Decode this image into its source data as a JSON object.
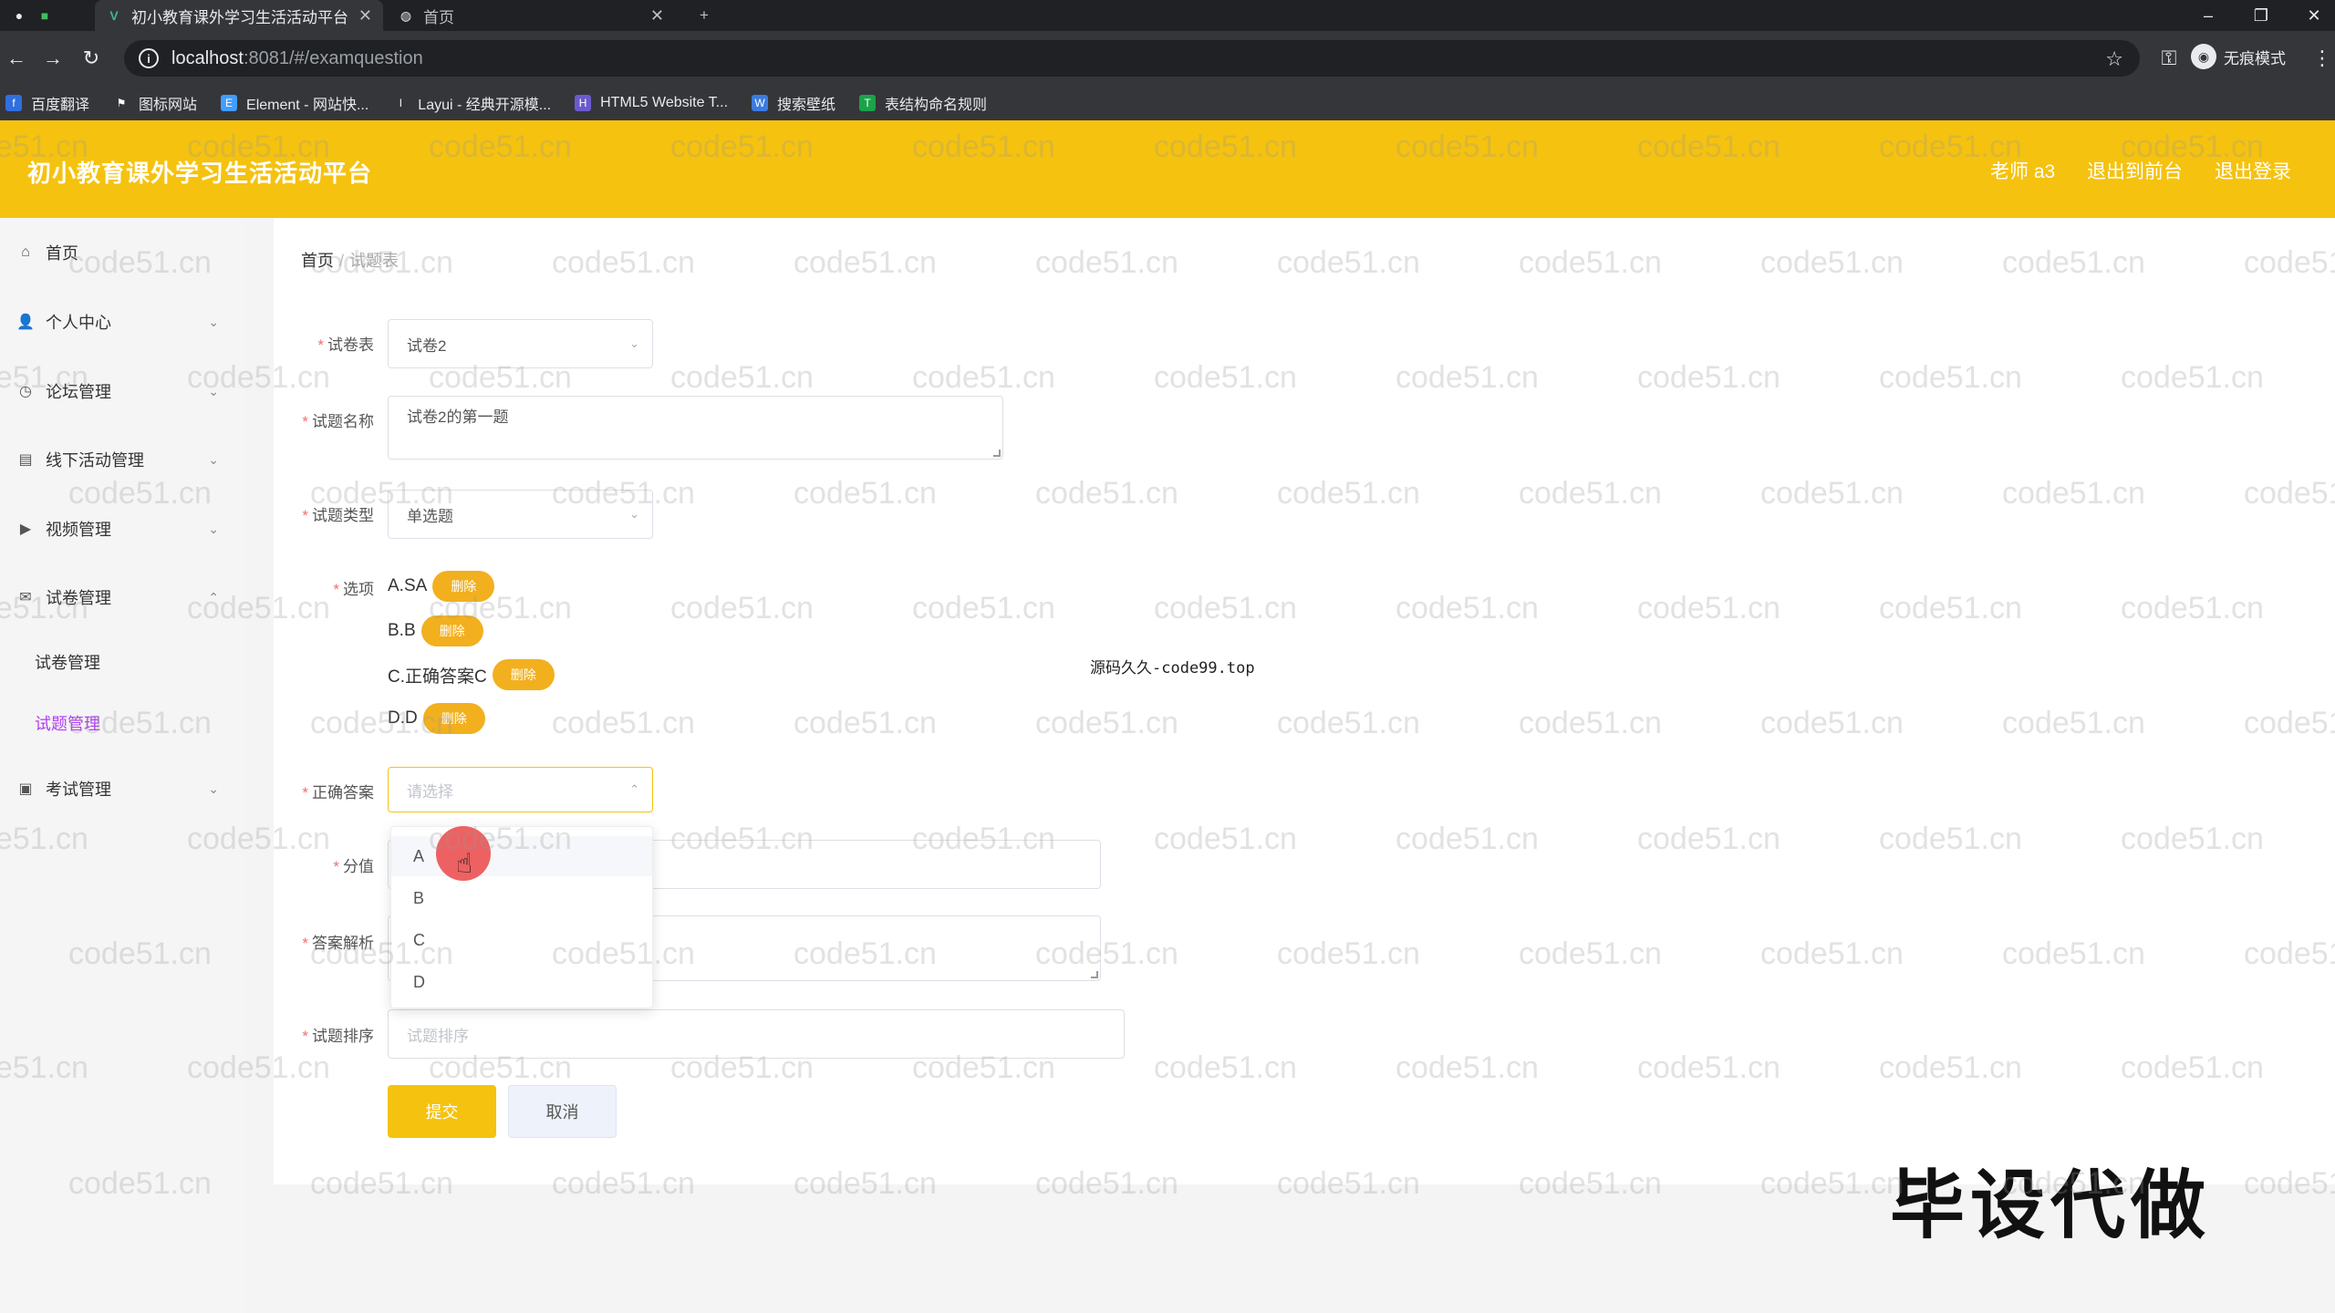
{
  "browser": {
    "tabs": [
      {
        "title": "初小教育课外学习生活活动平台",
        "active": true
      },
      {
        "title": "首页",
        "active": false
      }
    ],
    "url_host": "localhost",
    "url_path": ":8081/#/examquestion",
    "profile": "无痕模式",
    "bookmarks": [
      "百度翻译",
      "图标网站",
      "Element - 网站快...",
      "Layui - 经典开源模...",
      "HTML5 Website T...",
      "搜索壁纸",
      "表结构命名规则"
    ]
  },
  "header": {
    "title": "初小教育课外学习生活活动平台",
    "user": "老师 a3",
    "front_link": "退出到前台",
    "logout_link": "退出登录"
  },
  "sidebar": {
    "items": [
      {
        "label": "首页",
        "icon": "home-icon"
      },
      {
        "label": "个人中心",
        "icon": "user-icon"
      },
      {
        "label": "论坛管理",
        "icon": "clock-icon"
      },
      {
        "label": "线下活动管理",
        "icon": "doc-icon"
      },
      {
        "label": "视频管理",
        "icon": "video-icon"
      },
      {
        "label": "试卷管理",
        "icon": "mail-icon"
      },
      {
        "label": "考试管理",
        "icon": "briefcase-icon"
      }
    ],
    "subitems": [
      "试卷管理",
      "试题管理"
    ]
  },
  "breadcrumb": {
    "home": "首页",
    "sep": "/",
    "current": "试题表"
  },
  "form": {
    "paper_label": "试卷表",
    "paper_value": "试卷2",
    "name_label": "试题名称",
    "name_value": "试卷2的第一题",
    "type_label": "试题类型",
    "type_value": "单选题",
    "options_label": "选项",
    "options": [
      "A.SA",
      "B.B",
      "C.正确答案C",
      "D.D"
    ],
    "delete_label": "删除",
    "answer_label": "正确答案",
    "answer_placeholder": "请选择",
    "score_label": "分值",
    "analysis_label": "答案解析",
    "order_label": "试题排序",
    "order_placeholder": "试题排序",
    "submit": "提交",
    "cancel": "取消"
  },
  "dropdown": [
    "A",
    "B",
    "C",
    "D"
  ],
  "overlay": {
    "note": "源码久久-code99.top",
    "big_mark": "毕设代做",
    "watermark": "code51.cn"
  },
  "colors": {
    "header": "#f5c20f",
    "delete": "#f2b01e",
    "active_sub": "#b23cf5"
  }
}
